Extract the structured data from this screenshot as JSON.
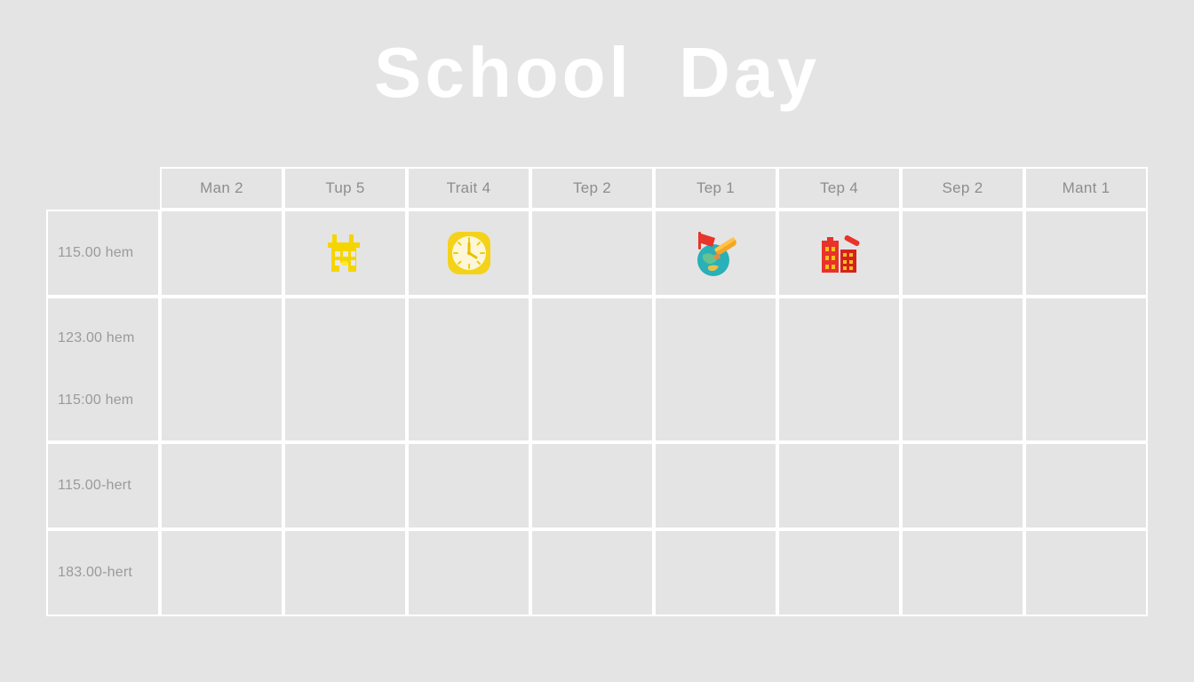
{
  "page": {
    "title": "School  Day",
    "background_color": "#e4e4e4",
    "title_color": "#ffffff",
    "grid_line_color": "#ffffff",
    "header_text_color": "#8d8d8d",
    "label_text_color": "#9a9a9a"
  },
  "table": {
    "corner_label": "",
    "column_headers": [
      "Man 2",
      "Tup 5",
      "Trait 4",
      "Tep 2",
      "Tep 1",
      "Tep 4",
      "Sep 2",
      "Mant 1"
    ],
    "rows": [
      {
        "labels": [
          "115.00 hem"
        ],
        "cells": [
          "",
          "school-building-icon",
          "clock-icon",
          "",
          "globe-flag-icon",
          "buildings-icon",
          "",
          ""
        ]
      },
      {
        "labels": [
          "123.00 hem",
          "115:00 hem"
        ],
        "cells": [
          "",
          "",
          "",
          "",
          "",
          "",
          "",
          ""
        ]
      },
      {
        "labels": [
          "115.00-hert"
        ],
        "cells": [
          "",
          "",
          "",
          "",
          "",
          "",
          "",
          ""
        ]
      },
      {
        "labels": [
          "183.00-hert"
        ],
        "cells": [
          "",
          "",
          "",
          "",
          "",
          "",
          "",
          ""
        ]
      }
    ]
  },
  "icons": {
    "school_building": {
      "name": "school-building-icon",
      "color": "#f5d500",
      "accent_color": "#ffe833"
    },
    "clock": {
      "name": "clock-icon",
      "frame_color": "#f5d21a",
      "face_color": "#fdf7d8",
      "hand_color": "#e8c000"
    },
    "globe_flag": {
      "name": "globe-flag-icon",
      "globe_color": "#29b0b8",
      "land_color": "#6fc78a",
      "flag_color": "#e8342a",
      "pole_color": "#f5a623"
    },
    "buildings": {
      "name": "buildings-icon",
      "building_color": "#e8322a",
      "building_dark": "#d6211c",
      "window_color": "#f7c21a"
    }
  }
}
